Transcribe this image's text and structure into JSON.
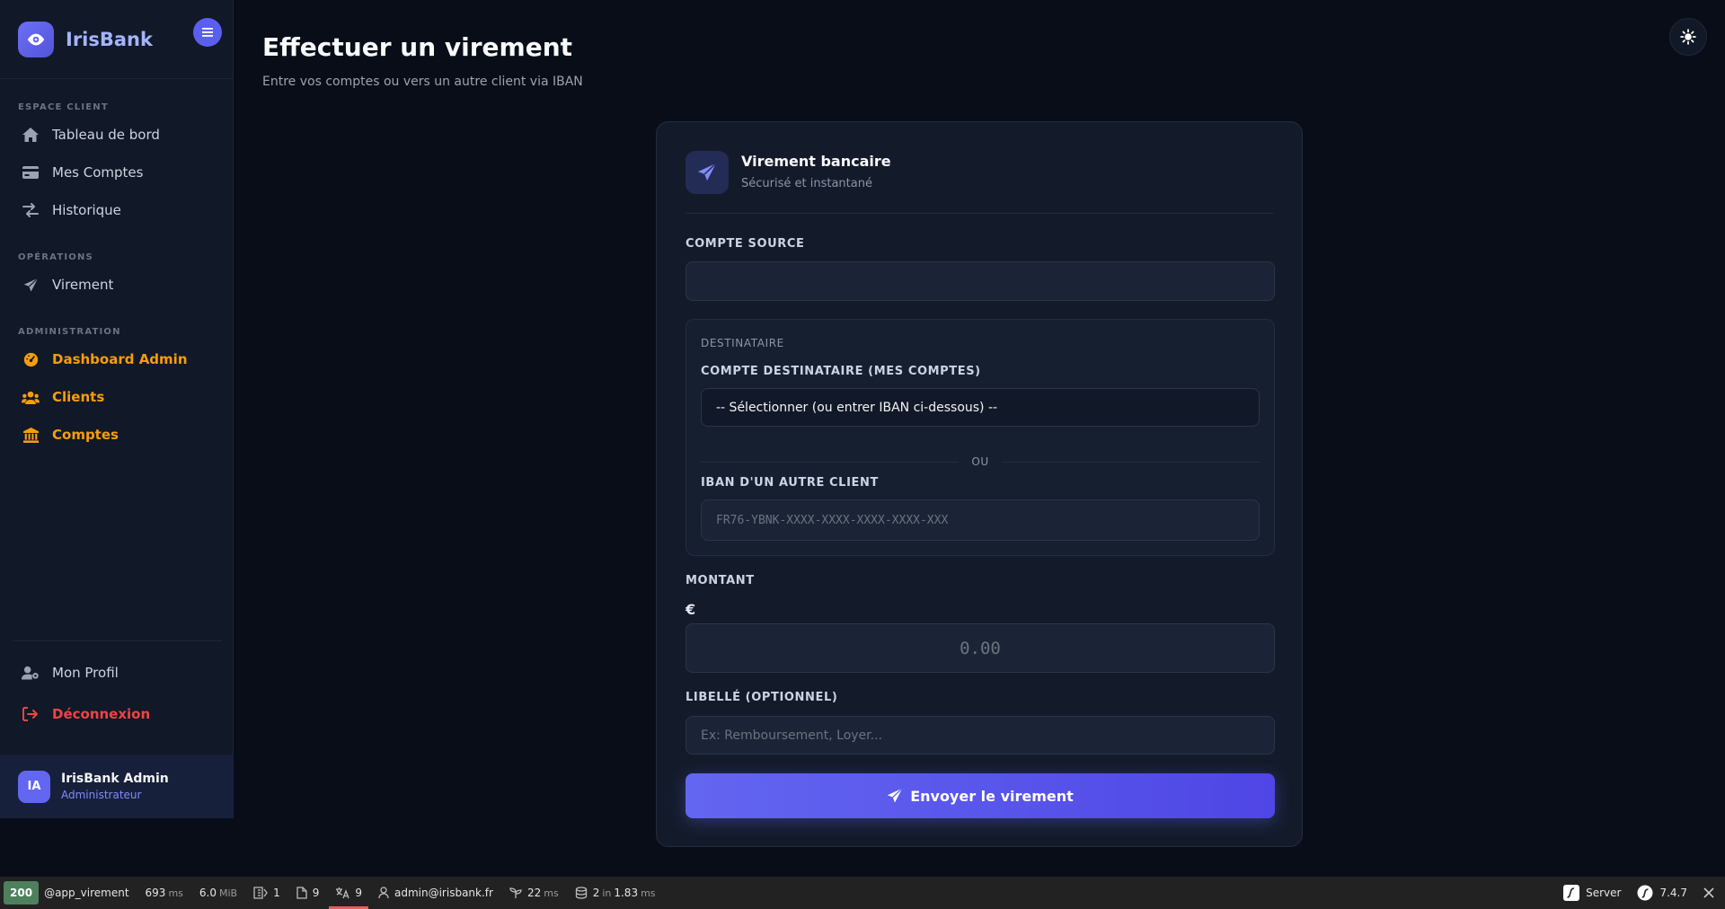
{
  "brand": {
    "name": "IrisBank"
  },
  "sidebar": {
    "sections": [
      {
        "title": "ESPACE CLIENT",
        "items": [
          {
            "label": "Tableau de bord",
            "icon": "home-icon"
          },
          {
            "label": "Mes Comptes",
            "icon": "credit-card-icon"
          },
          {
            "label": "Historique",
            "icon": "exchange-icon"
          }
        ]
      },
      {
        "title": "OPÉRATIONS",
        "items": [
          {
            "label": "Virement",
            "icon": "paper-plane-icon"
          }
        ]
      },
      {
        "title": "ADMINISTRATION",
        "items": [
          {
            "label": "Dashboard Admin",
            "icon": "gauge-icon"
          },
          {
            "label": "Clients",
            "icon": "users-icon"
          },
          {
            "label": "Comptes",
            "icon": "bank-icon"
          }
        ]
      }
    ],
    "bottom": {
      "profile": "Mon Profil",
      "logout": "Déconnexion"
    },
    "user": {
      "initials": "IA",
      "name": "IrisBank Admin",
      "role": "Administrateur"
    }
  },
  "page": {
    "title": "Effectuer un virement",
    "subtitle": "Entre vos comptes ou vers un autre client via IBAN"
  },
  "card": {
    "title": "Virement bancaire",
    "subtitle": "Sécurisé et instantané",
    "source_label": "COMPTE SOURCE",
    "source_value": "",
    "dest_section": "DESTINATAIRE",
    "dest_account_label": "COMPTE DESTINATAIRE (MES COMPTES)",
    "dest_account_selected": "-- Sélectionner (ou entrer IBAN ci-dessous) --",
    "or_text": "OU",
    "iban_label": "IBAN D'UN AUTRE CLIENT",
    "iban_placeholder": "FR76-YBNK-XXXX-XXXX-XXXX-XXXX-XXX",
    "amount_label": "MONTANT",
    "currency": "€",
    "amount_placeholder": "0.00",
    "memo_label": "LIBELLÉ (OPTIONNEL)",
    "memo_placeholder": "Ex: Remboursement, Loyer...",
    "submit_label": "Envoyer le virement"
  },
  "toolbar": {
    "status": "200",
    "route": "@app_virement",
    "time": "693",
    "time_unit": "ms",
    "memory": "6.0",
    "memory_unit": "MiB",
    "logs": "1",
    "forms": "9",
    "translations": "9",
    "user": "admin@irisbank.fr",
    "twig": "22",
    "twig_unit": "ms",
    "db_queries": "2",
    "db_in": "in",
    "db_time": "1.83",
    "db_unit": "ms",
    "server": "Server",
    "version": "7.4.7"
  },
  "colors": {
    "accent": "#6366f1",
    "admin": "#f59e0b",
    "danger": "#ef4444",
    "background": "#080d18"
  }
}
